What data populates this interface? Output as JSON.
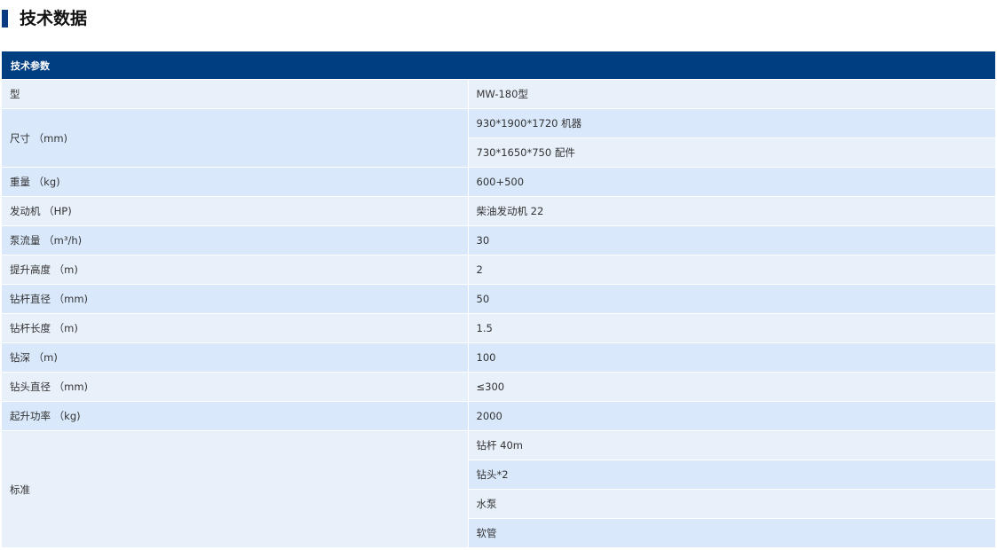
{
  "section": {
    "title": "技术数据"
  },
  "table": {
    "header": "技术参数",
    "rows": {
      "r0": {
        "label": "型",
        "value": "MW-180型"
      },
      "r1": {
        "label": "尺寸 （mm)",
        "value_a": "930*1900*1720 机器",
        "value_b": "730*1650*750 配件"
      },
      "r2": {
        "label": "重量 （kg)",
        "value": "600+500"
      },
      "r3": {
        "label": "发动机 （HP)",
        "value": "柴油发动机 22"
      },
      "r4": {
        "label": "泵流量 （m³/h)",
        "value": "30"
      },
      "r5": {
        "label": "提升高度 （m)",
        "value": "2"
      },
      "r6": {
        "label": "钻杆直径 （mm)",
        "value": "50"
      },
      "r7": {
        "label": "钻杆长度 （m)",
        "value": "1.5"
      },
      "r8": {
        "label": "钻深 （m)",
        "value": "100"
      },
      "r9": {
        "label": "钻头直径 （mm)",
        "value": "≤300"
      },
      "r10": {
        "label": "起升功率 （kg)",
        "value": "2000"
      },
      "r11": {
        "label": "标准",
        "v1": "钻杆 40m",
        "v2": "钻头*2",
        "v3": "水泵",
        "v4": "软管"
      }
    }
  },
  "colors": {
    "header_bg": "#003e82",
    "accent_bar": "#0b3c82",
    "row_light": "#e8f0fa",
    "row_blue": "#d9e8fb"
  }
}
